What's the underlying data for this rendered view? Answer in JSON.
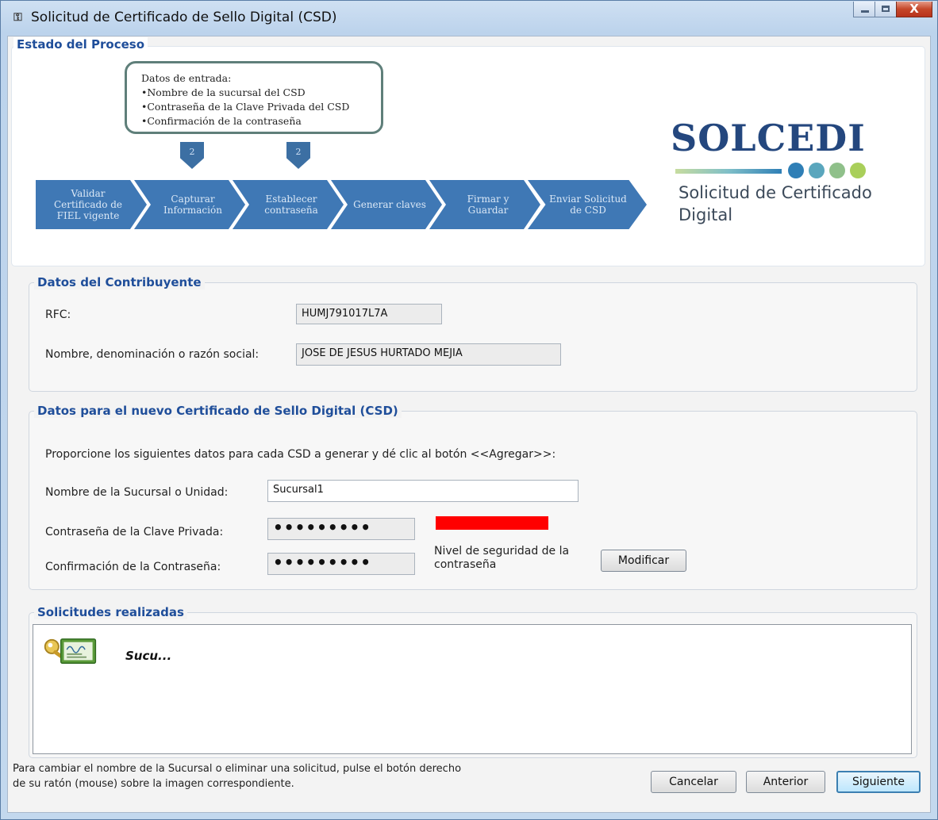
{
  "window": {
    "title": "Solicitud de Certificado de Sello Digital (CSD)",
    "icon": "app-icon",
    "close_glyph": "X"
  },
  "process": {
    "title": "Estado del Proceso",
    "callout": {
      "heading": "Datos de entrada:",
      "items": [
        "•Nombre de la sucursal del CSD",
        "•Contraseña de la Clave Privada del CSD",
        "•Confirmación de la contraseña"
      ]
    },
    "badges": [
      "2",
      "2"
    ],
    "steps": [
      "Validar Certificado de FIEL vigente",
      "Capturar Información",
      "Establecer contraseña",
      "Generar claves",
      "Firmar y Guardar",
      "Enviar Solicitud de CSD"
    ],
    "logo": {
      "word": "SOLCEDI",
      "subtitle": "Solicitud de Certificado Digital",
      "dot_colors": [
        "#2f7fb6",
        "#5aa6bd",
        "#8fc08a",
        "#a9cf5a"
      ]
    }
  },
  "contribuyente": {
    "title": "Datos del Contribuyente",
    "rfc_label": "RFC:",
    "rfc_value": "HUMJ791017L7A",
    "name_label": "Nombre, denominación o razón social:",
    "name_value": "JOSE DE JESUS HURTADO MEJIA"
  },
  "csd": {
    "title": "Datos para el nuevo Certificado de Sello Digital (CSD)",
    "instructions": "Proporcione los siguientes datos para cada CSD a generar y dé clic al botón <<Agregar>>:",
    "sucursal_label": "Nombre de la Sucursal o Unidad:",
    "sucursal_value": "Sucursal1",
    "password_label": "Contraseña de la Clave Privada:",
    "password_value": "•••••••••",
    "confirm_label": "Confirmación de la Contraseña:",
    "confirm_value": "•••••••••",
    "strength_label": "Nivel de seguridad de la contraseña",
    "strength_color": "#ff0000",
    "modify_button": "Modificar"
  },
  "solicitudes": {
    "title": "Solicitudes realizadas",
    "items": [
      {
        "label": "Sucu...",
        "icon": "certificate-key-icon"
      }
    ]
  },
  "footer": {
    "hint": "Para cambiar el nombre de la Sucursal o eliminar una solicitud, pulse el botón derecho de su ratón (mouse) sobre la imagen correspondiente.",
    "cancel": "Cancelar",
    "previous": "Anterior",
    "next": "Siguiente"
  }
}
